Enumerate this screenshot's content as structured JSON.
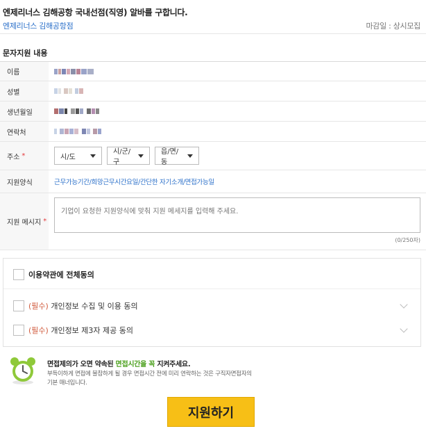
{
  "header": {
    "job_title": "엔제리너스 김해공항 국내선점(직영) 알바를 구합니다.",
    "company": "엔제리너스 김해공항점",
    "deadline": "마감일 : 상시모집"
  },
  "section_title": "문자지원 내용",
  "fields": {
    "name_label": "이름",
    "gender_label": "성별",
    "birth_label": "생년월일",
    "contact_label": "연락처",
    "address_label": "주소",
    "address_selects": [
      "시/도",
      "시/군/구",
      "읍/면/동"
    ],
    "apply_type_label": "지원양식",
    "apply_type_value": "근무가능기간/희망근무시간요일/간단한 자기소개/면접가능일",
    "message_label": "지원 메시지",
    "message_placeholder": "기업이 요청한 지원양식에 맞춰 지원 메세지를 입력해 주세요.",
    "char_count": "(0/250자)",
    "required_mark": "*"
  },
  "terms": {
    "all_agree": "이용약관에 전체동의",
    "items": [
      {
        "required_tag": "(필수)",
        "text": " 개인정보 수집 및 이용 동의"
      },
      {
        "required_tag": "(필수)",
        "text": " 개인정보 제3자 제공 동의"
      }
    ]
  },
  "notice": {
    "title_before": "면접제의가 오면 약속된 ",
    "title_highlight": "면접시간을 꼭",
    "title_after": " 지켜주세요.",
    "desc": "부득이하게 면접에 불참하게 될 경우 면접시간 전에 미리 연락하는 것은 구직자면접자의 기본 매너입니다."
  },
  "submit_label": "지원하기",
  "colors": {
    "accent": "#f7bf16",
    "link": "#2a6fc9",
    "required": "#e4393c",
    "highlight": "#4aa01b"
  }
}
